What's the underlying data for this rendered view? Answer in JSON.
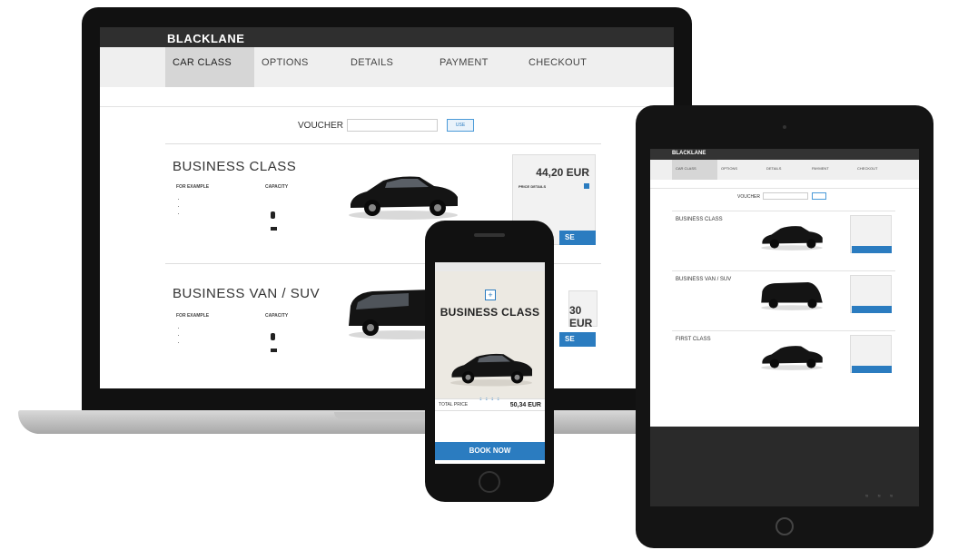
{
  "laptop": {
    "brand": "BLACKLANE",
    "steps": [
      "CAR CLASS",
      "OPTIONS",
      "DETAILS",
      "PAYMENT",
      "CHECKOUT"
    ],
    "voucher": {
      "label": "VOUCHER",
      "button": "USE"
    },
    "cards": [
      {
        "title": "BUSINESS CLASS",
        "example_header": "FOR EXAMPLE",
        "capacity_header": "CAPACITY",
        "price": "44,20 EUR",
        "price_details_label": "PRICE DETAILS",
        "choose_label": "SE"
      },
      {
        "title": "BUSINESS VAN / SUV",
        "example_header": "FOR EXAMPLE",
        "capacity_header": "CAPACITY",
        "price": "30 EUR",
        "choose_label": "SE"
      }
    ]
  },
  "phone": {
    "title": "BUSINESS CLASS",
    "total_label": "TOTAL PRICE",
    "total_value": "50,34 EUR",
    "book_button": "BOOK NOW"
  },
  "tablet": {
    "brand": "BLACKLANE",
    "steps": [
      "CAR CLASS",
      "OPTIONS",
      "DETAILS",
      "PAYMENT",
      "CHECKOUT"
    ],
    "voucher_label": "VOUCHER",
    "cards": [
      {
        "title": "BUSINESS CLASS"
      },
      {
        "title": "BUSINESS VAN / SUV"
      },
      {
        "title": "FIRST CLASS"
      }
    ]
  },
  "colors": {
    "accent": "#2b7cc0",
    "header_dark": "#2f2f2f",
    "device_frame": "#111111"
  }
}
